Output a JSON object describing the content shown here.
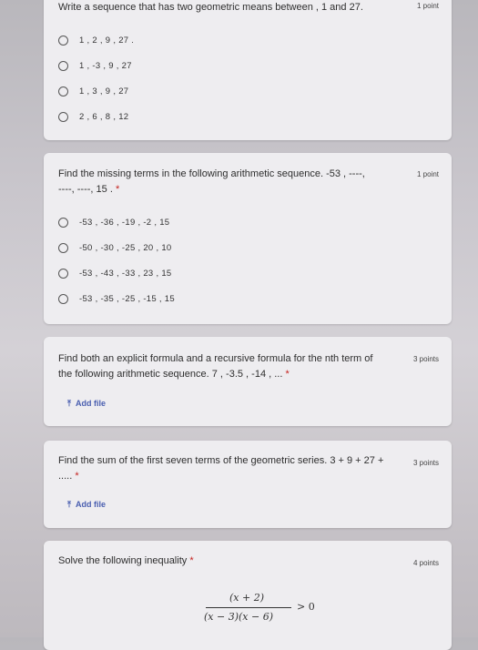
{
  "q1": {
    "text": "Write a sequence that has two geometric means between , 1 and 27.",
    "points": "1 point",
    "options": [
      "1 , 2 , 9 , 27 .",
      "1 , -3 , 9 , 27",
      "1 , 3 , 9 , 27",
      "2 , 6 , 8 , 12"
    ]
  },
  "q2": {
    "text_line1": "Find the missing terms in the following arithmetic sequence. -53 , ----,",
    "text_line2": "----, ----, 15 .",
    "required": "*",
    "points": "1 point",
    "options": [
      "-53 , -36 , -19 , -2 , 15",
      "-50 , -30 , -25 , 20 , 10",
      "-53 , -43 , -33 , 23 , 15",
      "-53 , -35 , -25 , -15 , 15"
    ]
  },
  "q3": {
    "text_line1": "Find both an explicit formula and a recursive formula for the nth term of",
    "text_line2": "the following arithmetic sequence. 7 , -3.5 , -14 , ... ",
    "required": "*",
    "points": "3 points",
    "add_file": "Add file"
  },
  "q4": {
    "text_line1": "Find the sum of the first seven terms of the geometric series. 3 + 9 + 27 +",
    "text_line2": ".....",
    "required": "*",
    "points": "3 points",
    "add_file": "Add file"
  },
  "q5": {
    "text": "Solve the following inequality",
    "required": "*",
    "points": "4 points",
    "numerator": "(x + 2)",
    "denominator": "(x − 3)(x − 6)",
    "relation": "> 0"
  },
  "icons": {
    "upload": "upload-icon"
  },
  "colors": {
    "accent": "#4a5fb0",
    "required": "#c5221f",
    "card": "#eeedf0"
  }
}
